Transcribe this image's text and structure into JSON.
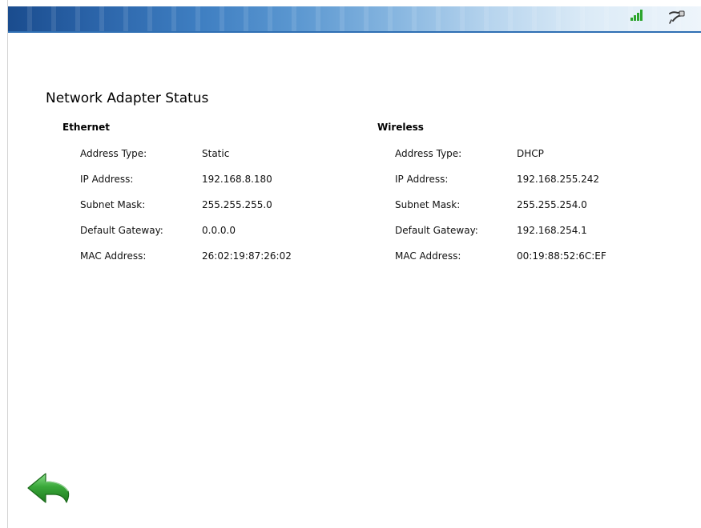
{
  "header": {
    "signal_icon": "signal-strength-icon",
    "network_icon": "network-plug-icon",
    "gradient_start": "#1a4c8e",
    "gradient_end": "#eef5fb",
    "signal_color": "#2da52d"
  },
  "page": {
    "title": "Network Adapter Status"
  },
  "ethernet": {
    "header": "Ethernet",
    "rows": [
      {
        "label": "Address Type:",
        "value": "Static"
      },
      {
        "label": "IP Address:",
        "value": "192.168.8.180"
      },
      {
        "label": "Subnet Mask:",
        "value": "255.255.255.0"
      },
      {
        "label": "Default Gateway:",
        "value": "0.0.0.0"
      },
      {
        "label": "MAC Address:",
        "value": "26:02:19:87:26:02"
      }
    ]
  },
  "wireless": {
    "header": "Wireless",
    "rows": [
      {
        "label": "Address Type:",
        "value": "DHCP"
      },
      {
        "label": "IP Address:",
        "value": "192.168.255.242"
      },
      {
        "label": "Subnet Mask:",
        "value": "255.255.254.0"
      },
      {
        "label": "Default Gateway:",
        "value": "192.168.254.1"
      },
      {
        "label": "MAC Address:",
        "value": "00:19:88:52:6C:EF"
      }
    ]
  },
  "footer": {
    "back_icon": "back-arrow-icon",
    "back_color": "#3aa83a"
  }
}
